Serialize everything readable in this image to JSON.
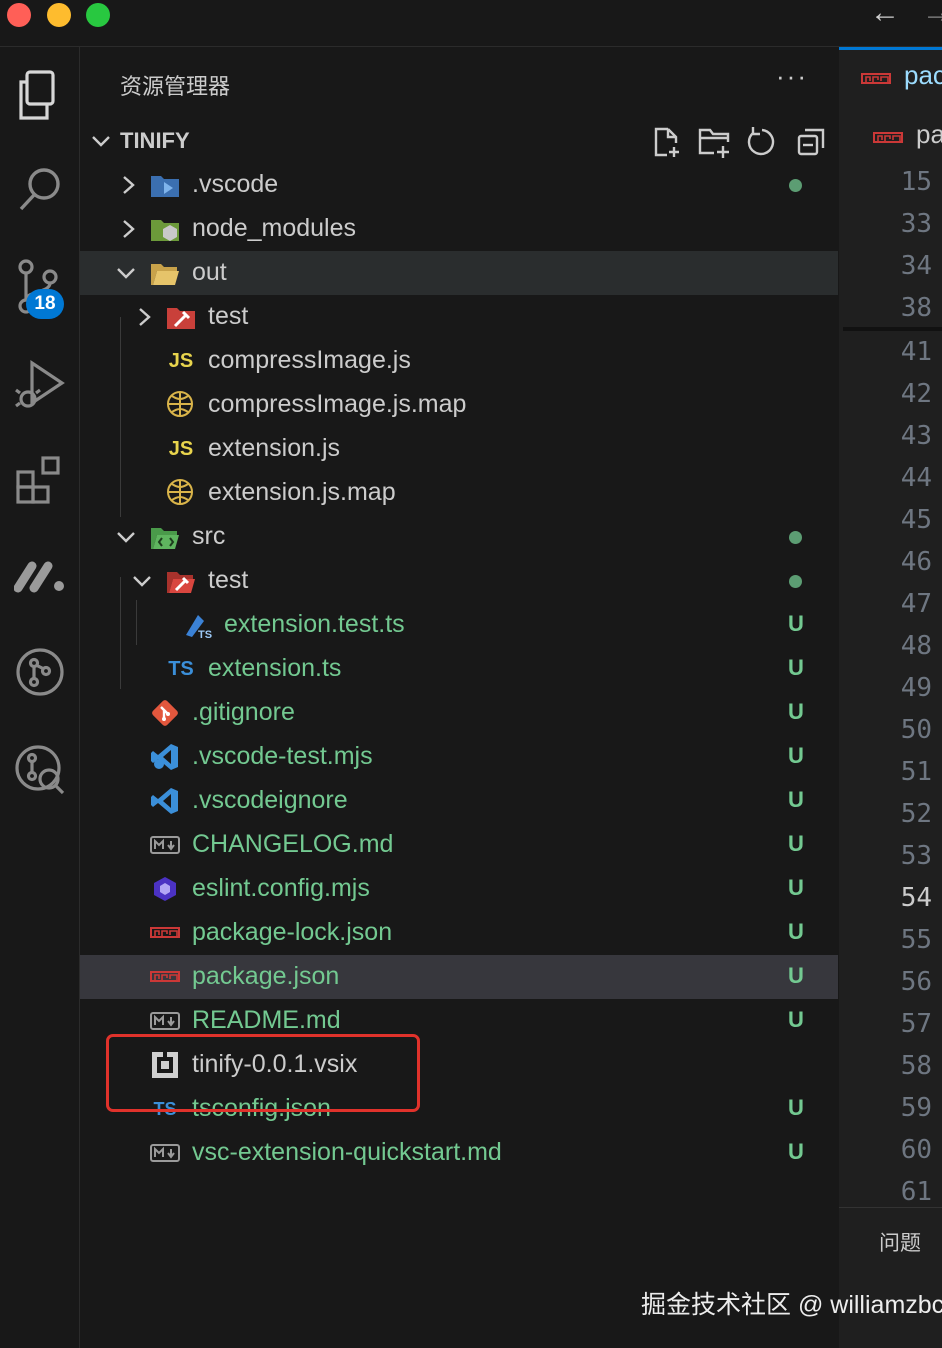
{
  "window": {
    "nav_back_glyph": "←",
    "nav_forward_glyph": "→"
  },
  "activity_bar": {
    "items": [
      "explorer-icon",
      "search-icon",
      "source-control-icon",
      "run-debug-icon",
      "extensions-icon",
      "monday-icon",
      "git-graph-icon",
      "git-lens-icon"
    ],
    "scm_badge": "18"
  },
  "sidebar": {
    "title": "资源管理器",
    "more": "···",
    "folder": "TINIFY",
    "tree": [
      {
        "name": ".vscode",
        "decor": "dot"
      },
      {
        "name": "node_modules",
        "decor": ""
      },
      {
        "name": "out",
        "decor": ""
      },
      {
        "name": "test",
        "decor": ""
      },
      {
        "name": "compressImage.js",
        "decor": "",
        "icon_text": "JS"
      },
      {
        "name": "compressImage.js.map",
        "decor": ""
      },
      {
        "name": "extension.js",
        "decor": "",
        "icon_text": "JS"
      },
      {
        "name": "extension.js.map",
        "decor": ""
      },
      {
        "name": "src",
        "decor": "dot"
      },
      {
        "name": "test",
        "decor": "dot"
      },
      {
        "name": "extension.test.ts",
        "decor": "U"
      },
      {
        "name": "extension.ts",
        "decor": "U",
        "icon_text": "TS"
      },
      {
        "name": ".gitignore",
        "decor": "U"
      },
      {
        "name": ".vscode-test.mjs",
        "decor": "U"
      },
      {
        "name": ".vscodeignore",
        "decor": "U"
      },
      {
        "name": "CHANGELOG.md",
        "decor": "U"
      },
      {
        "name": "eslint.config.mjs",
        "decor": "U"
      },
      {
        "name": "package-lock.json",
        "decor": "U"
      },
      {
        "name": "package.json",
        "decor": "U"
      },
      {
        "name": "README.md",
        "decor": "U"
      },
      {
        "name": "tinify-0.0.1.vsix",
        "decor": ""
      },
      {
        "name": "tsconfig.json",
        "decor": "U"
      },
      {
        "name": "vsc-extension-quickstart.md",
        "decor": "U"
      }
    ]
  },
  "editor": {
    "tabs": [
      "pac",
      "pa"
    ],
    "line_numbers": [
      "15",
      "33",
      "34",
      "38",
      "41",
      "42",
      "43",
      "44",
      "45",
      "46",
      "47",
      "48",
      "49",
      "50",
      "51",
      "52",
      "53",
      "54",
      "55",
      "56",
      "57",
      "58",
      "59",
      "60",
      "61"
    ],
    "current_line": "54",
    "panel_label": "问题"
  },
  "watermark": "掘金技术社区 @ williamzbc",
  "colors": {
    "untracked": "#73c991",
    "highlight_box": "#e0322b",
    "badge": "#0078d4"
  }
}
